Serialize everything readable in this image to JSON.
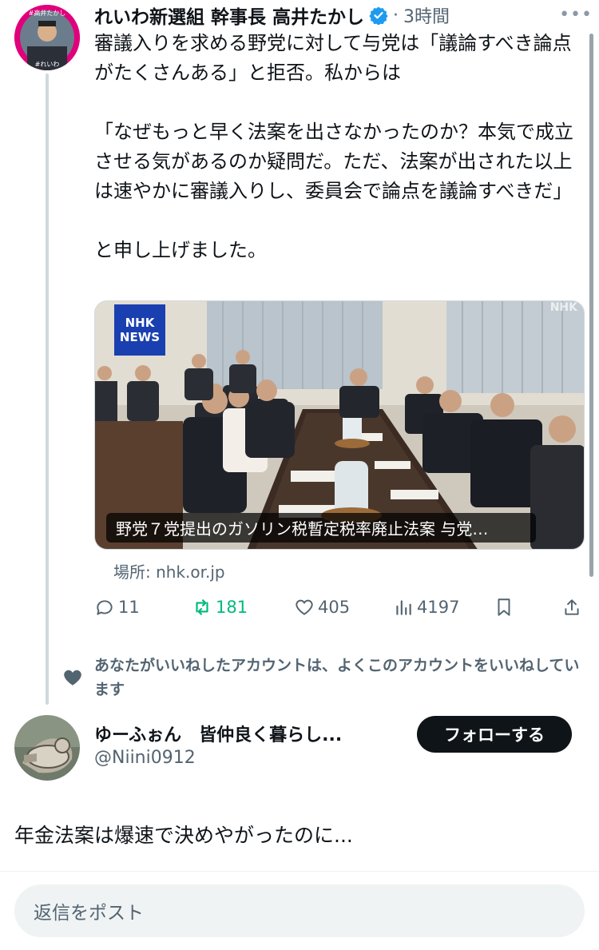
{
  "tweet": {
    "avatar_labels": [
      "#高井たかし",
      "#れいわ"
    ],
    "author": "れいわ新選組 幹事長 高井たかし",
    "separator": "·",
    "time": "3時間",
    "more_icon": "more-icon",
    "text": "審議入りを求める野党に対して与党は「議論すべき論点がたくさんある」と拒否。私からは\n\n「なぜもっと早く法案を出さなかったのか？本気で成立させる気があるのか疑問だ。ただ、法案が出された以上は速やかに審議入りし、委員会で論点を議論すべきだ」\n\nと申し上げました。",
    "media": {
      "logo_line1": "NHK",
      "logo_line2": "NEWS",
      "watermark": "NHK",
      "caption": "野党７党提出のガソリン税暫定税率廃止法案 与党…"
    },
    "source": "場所: nhk.or.jp",
    "actions": {
      "replies": "11",
      "reposts": "181",
      "likes": "405",
      "views": "4197"
    }
  },
  "social_context": "あなたがいいねしたアカウントは、よくこのアカウントをいいねしています",
  "suggested_user": {
    "name": "ゆーふぉん　皆仲良く暮らし...",
    "handle": "@Niini0912",
    "follow_label": "フォローする",
    "reply_text": "年金法案は爆速で決めやがったのに..."
  },
  "composer": {
    "placeholder": "返信をポスト"
  },
  "colors": {
    "accent_green": "#00ba7c",
    "verified_blue": "#1d9bf0",
    "secondary_text": "#536471",
    "avatar_pink": "#e0007b"
  }
}
